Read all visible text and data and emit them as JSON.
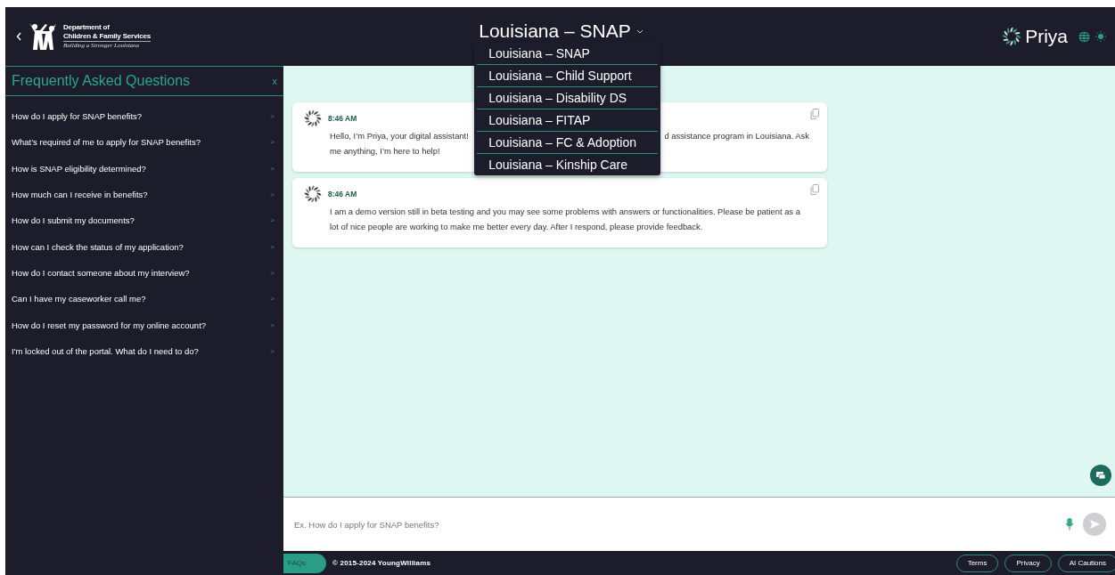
{
  "header": {
    "logo": {
      "lines": [
        "Department of",
        "Children & Family Services",
        "Building a Stronger Louisiana"
      ]
    },
    "program_selector": {
      "label": "Louisiana – SNAP",
      "expanded": true,
      "options": [
        {
          "label": "Louisiana – SNAP"
        },
        {
          "label": "Louisiana – Child Support"
        },
        {
          "label": "Louisiana – Disability DS"
        },
        {
          "label": "Louisiana – FITAP"
        },
        {
          "label": "Louisiana – FC & Adoption"
        },
        {
          "label": "Louisiana – Kinship Care"
        }
      ]
    },
    "brand": {
      "name": "Priya"
    }
  },
  "faq_panel": {
    "title": "Frequently Asked Questions",
    "close": "x",
    "items": [
      {
        "question": "How do I apply for SNAP benefits?",
        "arrow": ">"
      },
      {
        "question": "What’s required of me to apply for SNAP benefits?",
        "arrow": ">"
      },
      {
        "question": "How is SNAP eligibility determined?",
        "arrow": ">"
      },
      {
        "question": "How much can I receive in benefits?",
        "arrow": ">"
      },
      {
        "question": "How do I submit my documents?",
        "arrow": ">"
      },
      {
        "question": "How can I check the status of my application?",
        "arrow": ">"
      },
      {
        "question": "How do I contact someone about my interview?",
        "arrow": ">"
      },
      {
        "question": "Can I have my caseworker call me?",
        "arrow": ">"
      },
      {
        "question": "How do I reset my password for my online account?",
        "arrow": ">"
      },
      {
        "question": "I'm locked out of the portal. What do I need to do?",
        "arrow": ">"
      }
    ]
  },
  "messages": [
    {
      "time": "8:46 AM",
      "lines": [
        [
          "Hello, I’m Priya, your digital assistant!",
          "d assistance program in Louisiana. Ask"
        ],
        [
          "me anything, I’m here to help!"
        ]
      ]
    },
    {
      "time": "8:46 AM",
      "lines": [
        [
          "I am a demo version still in beta testing and you may see some problems with answers or functionalities. Please be patient as a lot of nice people are working to make me better every day. After I respond, please provide feedback."
        ]
      ]
    }
  ],
  "composer": {
    "placeholder": "Ex. How do I apply for SNAP benefits?"
  },
  "footer": {
    "faqs_tab": "FAQs",
    "copyright": "© 2015-2024 YoungWilliams",
    "links": [
      "Terms",
      "Privacy",
      "AI Cautions"
    ]
  }
}
